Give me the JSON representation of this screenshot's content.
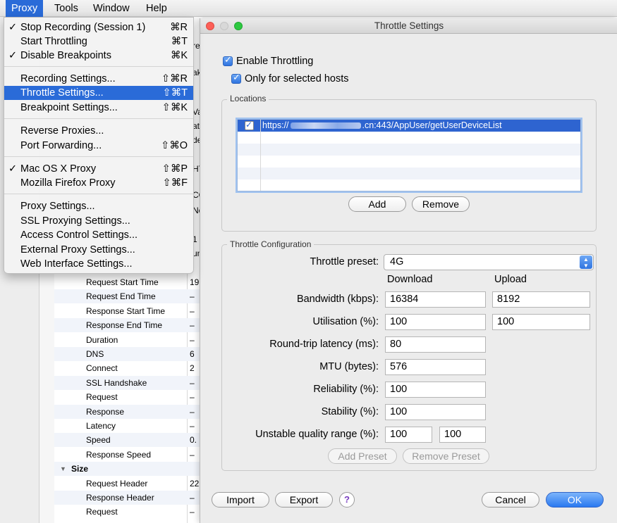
{
  "menubar": {
    "items": [
      {
        "label": "Proxy"
      },
      {
        "label": "Tools"
      },
      {
        "label": "Window"
      },
      {
        "label": "Help"
      }
    ]
  },
  "proxy_menu": {
    "items": [
      {
        "label": "Stop Recording (Session 1)",
        "checked": true,
        "shortcut": "⌘R"
      },
      {
        "label": "Start Throttling",
        "checked": false,
        "shortcut": "⌘T"
      },
      {
        "label": "Disable Breakpoints",
        "checked": true,
        "shortcut": "⌘K"
      },
      {
        "label": "Recording Settings...",
        "checked": false,
        "shortcut": "⇧⌘R"
      },
      {
        "label": "Throttle Settings...",
        "checked": false,
        "shortcut": "⇧⌘T",
        "highlighted": true
      },
      {
        "label": "Breakpoint Settings...",
        "checked": false,
        "shortcut": "⇧⌘K"
      },
      {
        "label": "Reverse Proxies...",
        "checked": false,
        "shortcut": ""
      },
      {
        "label": "Port Forwarding...",
        "checked": false,
        "shortcut": "⇧⌘O"
      },
      {
        "label": "Mac OS X Proxy",
        "checked": true,
        "shortcut": "⇧⌘P"
      },
      {
        "label": "Mozilla Firefox Proxy",
        "checked": false,
        "shortcut": "⇧⌘F"
      },
      {
        "label": "Proxy Settings...",
        "checked": false,
        "shortcut": ""
      },
      {
        "label": "SSL Proxying Settings...",
        "checked": false,
        "shortcut": ""
      },
      {
        "label": "Access Control Settings...",
        "checked": false,
        "shortcut": ""
      },
      {
        "label": "External Proxy Settings...",
        "checked": false,
        "shortcut": ""
      },
      {
        "label": "Web Interface Settings...",
        "checked": false,
        "shortcut": ""
      }
    ],
    "check_glyph": "✓"
  },
  "background": {
    "rows": [
      {
        "label": "Request Start Time",
        "value": "19"
      },
      {
        "label": "Request End Time",
        "value": "–"
      },
      {
        "label": "Response Start Time",
        "value": "–"
      },
      {
        "label": "Response End Time",
        "value": "–"
      },
      {
        "label": "Duration",
        "value": "–"
      },
      {
        "label": "DNS",
        "value": "6"
      },
      {
        "label": "Connect",
        "value": "2"
      },
      {
        "label": "SSL Handshake",
        "value": "–"
      },
      {
        "label": "Request",
        "value": "–"
      },
      {
        "label": "Response",
        "value": "–"
      },
      {
        "label": "Latency",
        "value": "–"
      },
      {
        "label": "Speed",
        "value": "0."
      },
      {
        "label": "Response Speed",
        "value": "–"
      },
      {
        "label": "Size",
        "value": "",
        "group": true
      },
      {
        "label": "Request Header",
        "value": "22"
      },
      {
        "label": "Response Header",
        "value": "–"
      },
      {
        "label": "Request",
        "value": "–"
      }
    ],
    "fragments": [
      "re",
      "ak",
      "Va",
      "att",
      "de",
      "HT",
      "CO",
      "No",
      "1",
      "un"
    ]
  },
  "dialog": {
    "title": "Throttle Settings",
    "enable_throttling": {
      "label": "Enable Throttling",
      "checked": true
    },
    "only_selected_hosts": {
      "label": "Only for selected hosts",
      "checked": true
    },
    "locations": {
      "title": "Locations",
      "rows": [
        {
          "enabled": true,
          "url_prefix": "https://",
          "url_suffix": ".cn:443/AppUser/getUserDeviceList"
        }
      ],
      "add_label": "Add",
      "remove_label": "Remove"
    },
    "config": {
      "title": "Throttle Configuration",
      "preset_label": "Throttle preset:",
      "preset_value": "4G",
      "download_header": "Download",
      "upload_header": "Upload",
      "bandwidth_label": "Bandwidth (kbps):",
      "bandwidth_download": "16384",
      "bandwidth_upload": "8192",
      "utilisation_label": "Utilisation (%):",
      "utilisation_download": "100",
      "utilisation_upload": "100",
      "latency_label": "Round-trip latency (ms):",
      "latency_value": "80",
      "mtu_label": "MTU (bytes):",
      "mtu_value": "576",
      "reliability_label": "Reliability (%):",
      "reliability_value": "100",
      "stability_label": "Stability (%):",
      "stability_value": "100",
      "unstable_label": "Unstable quality range (%):",
      "unstable_min": "100",
      "unstable_max": "100",
      "add_preset_label": "Add Preset",
      "remove_preset_label": "Remove Preset"
    },
    "footer": {
      "import_label": "Import",
      "export_label": "Export",
      "help_glyph": "?",
      "cancel_label": "Cancel",
      "ok_label": "OK"
    }
  },
  "colors": {
    "menu_highlight": "#2a6bd8",
    "list_selection": "#2e64d0",
    "ok_button": "#2a78f0"
  }
}
